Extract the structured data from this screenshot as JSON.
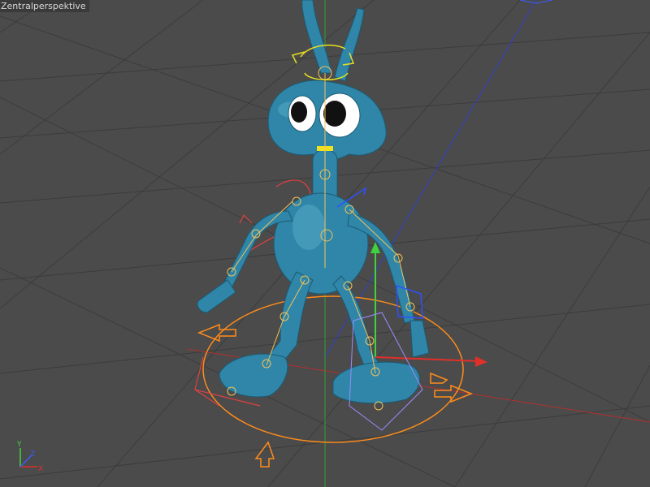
{
  "viewport": {
    "label": "Zentralperspektive",
    "background": "#4b4b4b",
    "grid_color": "#3d3d3d"
  },
  "axis_indicator": {
    "x_label": "X",
    "y_label": "Y",
    "z_label": "Z",
    "x_color": "#e0302a",
    "y_color": "#3fd43f",
    "z_color": "#3a5cff"
  },
  "character": {
    "body_color": "#2f86a8",
    "eye_color": "#ffffff",
    "pupil_color": "#111111",
    "mouth_color": "#f0e020"
  },
  "rig": {
    "skeleton_color": "#f2c25a",
    "ik_color": "#e04040",
    "control_ring_color": "#ff8c1a",
    "gizmo_color": "#2a4cff"
  }
}
